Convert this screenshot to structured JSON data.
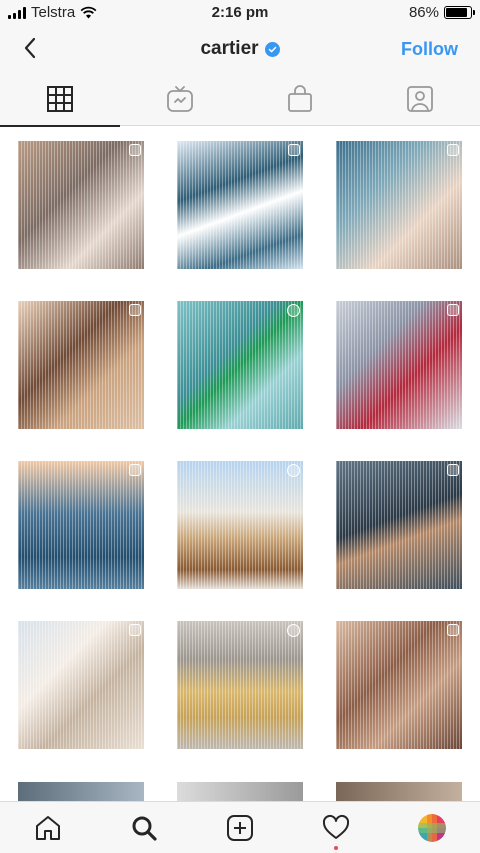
{
  "status_bar": {
    "carrier": "Telstra",
    "time": "2:16 pm",
    "battery_percent_label": "86%",
    "battery_level": 0.86,
    "signal_icon": "signal-bars-icon",
    "wifi_icon": "wifi-icon"
  },
  "header": {
    "title": "cartier",
    "verified_icon": "verified-badge-icon",
    "back_icon": "chevron-left-icon",
    "follow_label": "Follow"
  },
  "tabs": [
    {
      "icon": "grid-icon",
      "active": true
    },
    {
      "icon": "igtv-icon",
      "active": false
    },
    {
      "icon": "shopping-bag-icon",
      "active": false
    },
    {
      "icon": "tagged-person-icon",
      "active": false
    }
  ],
  "posts": [
    {
      "subject": "woman-with-ring",
      "badge": "multi-photo"
    },
    {
      "subject": "panther-bracelet",
      "badge": "multi-photo"
    },
    {
      "subject": "bracelet-on-wrist",
      "badge": "multi-photo"
    },
    {
      "subject": "man-portrait",
      "badge": "multi-photo"
    },
    {
      "subject": "emerald-ring",
      "badge": "video"
    },
    {
      "subject": "woman-red-bag",
      "badge": "multi-photo"
    },
    {
      "subject": "ocean-perfume",
      "badge": "multi-photo"
    },
    {
      "subject": "ballon-bleu-watch",
      "badge": "video"
    },
    {
      "subject": "woman-city-lights",
      "badge": "multi-photo"
    },
    {
      "subject": "perfume-bottle",
      "badge": "multi-photo"
    },
    {
      "subject": "tank-watch",
      "badge": "video"
    },
    {
      "subject": "hands-bracelets",
      "badge": "multi-photo"
    }
  ],
  "bottom_nav": [
    {
      "icon": "home-icon"
    },
    {
      "icon": "search-icon",
      "active": true
    },
    {
      "icon": "add-post-icon"
    },
    {
      "icon": "activity-heart-icon",
      "notification_dot": true
    },
    {
      "icon": "profile-avatar-icon"
    }
  ],
  "colors": {
    "accent": "#3897f0",
    "text": "#262626",
    "notification": "#ed4956",
    "bar_background": "#f7f7f7"
  }
}
